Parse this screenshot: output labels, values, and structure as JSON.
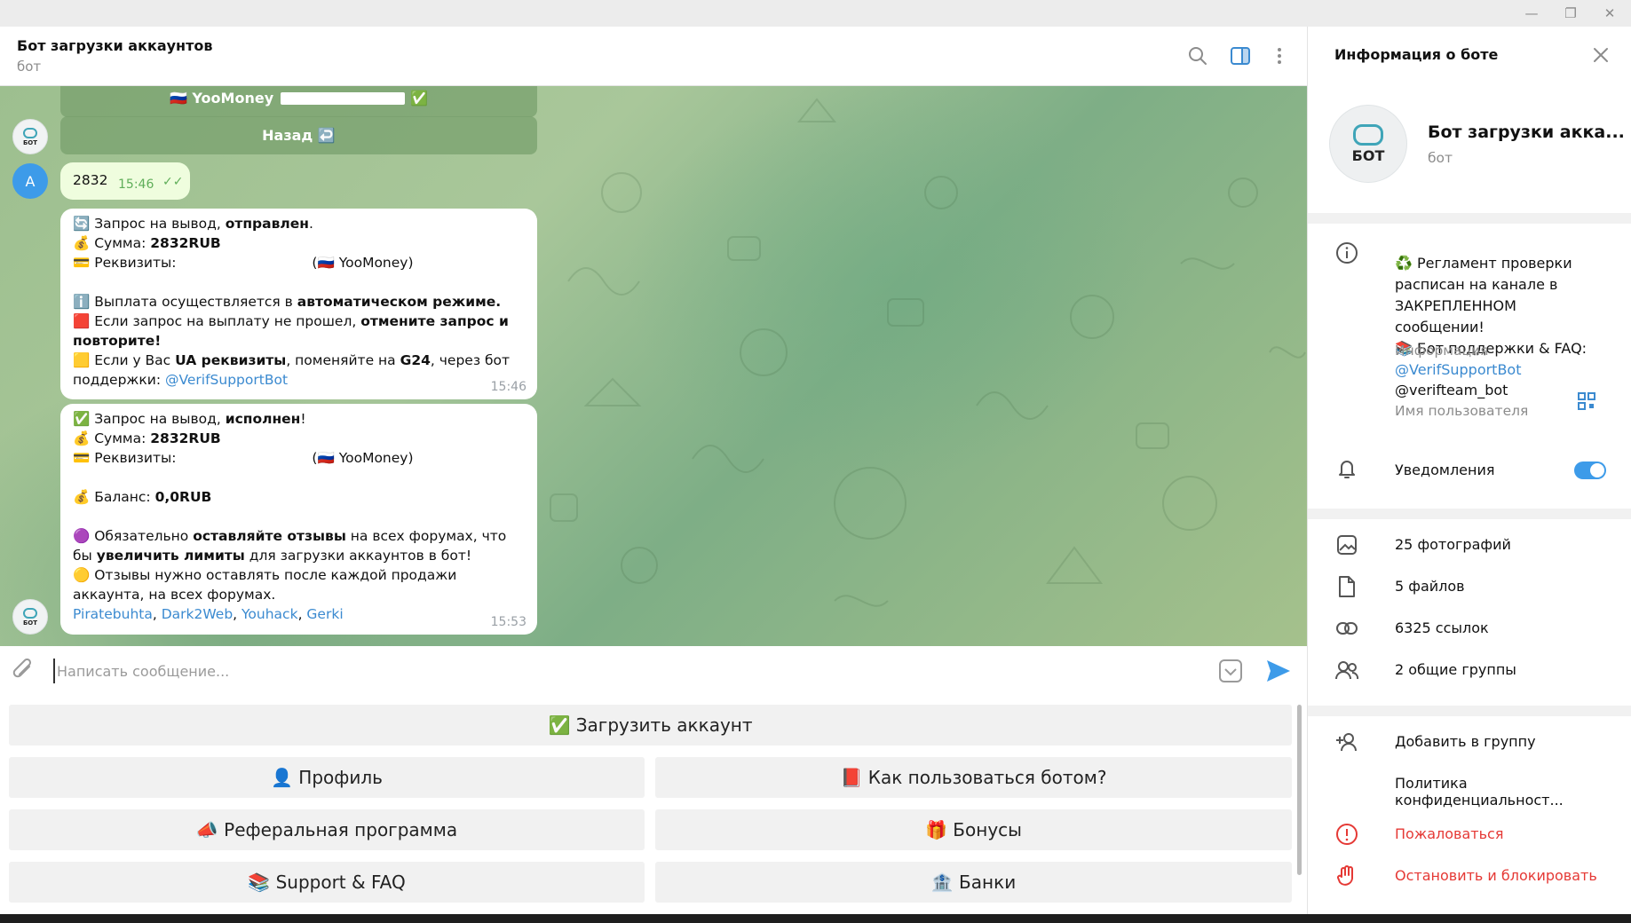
{
  "chat": {
    "title": "Бот загрузки аккаунтов",
    "subtitle": "бот",
    "bubbles_kb": {
      "yoomoney": "🇷🇺 YooMoney",
      "back": "Назад ↩️"
    },
    "user_avatar": "А",
    "bot_avatar_label": "БОТ",
    "user_message": {
      "text": "2832",
      "time": "15:46"
    },
    "msg1": {
      "l1a": "🔄 Запрос на вывод, ",
      "l1b": "отправлен",
      "l1c": ".",
      "l2a": "💰 Сумма: ",
      "l2b": "2832RUB",
      "l3a": "💳 Реквизиты: ",
      "l3b": "(🇷🇺 YooMoney)",
      "l4a": "ℹ️ Выплата осуществляется в ",
      "l4b": "автоматическом режиме.",
      "l5a": "🟥 Если запрос на выплату не прошел, ",
      "l5b": "отмените запрос и повторите!",
      "l6a": "🟨 Если у Вас ",
      "l6b": "UA реквизиты",
      "l6c": ", поменяйте на ",
      "l6d": "G24",
      "l6e": ", через бот поддержки: ",
      "l6f": "@VerifSupportBot",
      "time": "15:46"
    },
    "msg2": {
      "l1a": "✅ Запрос на вывод, ",
      "l1b": "исполнен",
      "l1c": "!",
      "l2a": "💰 Сумма: ",
      "l2b": "2832RUB",
      "l3a": "💳 Реквизиты: ",
      "l3b": "(🇷🇺 YooMoney)",
      "l4a": "💰 Баланс: ",
      "l4b": "0,0RUB",
      "l5a": "🟣 Обязательно ",
      "l5b": "оставляйте отзывы",
      "l5c": " на всех форумах, что бы ",
      "l5d": "увеличить лимиты",
      "l5e": " для загрузки аккаунтов в бот!",
      "l6": "🟡 Отзывы нужно оставлять после каждой продажи аккаунта, на всех форумах.",
      "links": [
        "Piratebuhta",
        "Dark2Web",
        "Youhack",
        "Gerki"
      ],
      "time": "15:53"
    },
    "input_placeholder": "Написать сообщение..."
  },
  "keyboard": {
    "upload": "✅ Загрузить аккаунт",
    "profile": "👤 Профиль",
    "howto": "📕 Как пользоваться ботом?",
    "referral": "📣 Реферальная программа",
    "bonuses": "🎁 Бонусы",
    "support": "📚 Support & FAQ",
    "banks": "🏦 Банки"
  },
  "info_panel": {
    "title": "Информация о боте",
    "name": "Бот загрузки акка...",
    "subtitle": "бот",
    "about": "♻️ Регламент проверки расписан на канале в ЗАКРЕПЛЕННОМ сообщении!\n📚 Бот поддержки & FAQ:",
    "about_link": "@VerifSupportBot",
    "about_label": "Информация",
    "username": "@verifteam_bot",
    "username_label": "Имя пользователя",
    "notifications": "Уведомления",
    "notifications_on": true,
    "photos": "25 фотографий",
    "files": "5 файлов",
    "links": "6325 ссылок",
    "groups": "2 общие группы",
    "add_to_group": "Добавить в группу",
    "privacy": "Политика конфиденциальност...",
    "report": "Пожаловаться",
    "block": "Остановить и блокировать"
  },
  "colors": {
    "accent": "#3b8ad0",
    "danger": "#e53935",
    "toggle": "#3d9be9"
  }
}
